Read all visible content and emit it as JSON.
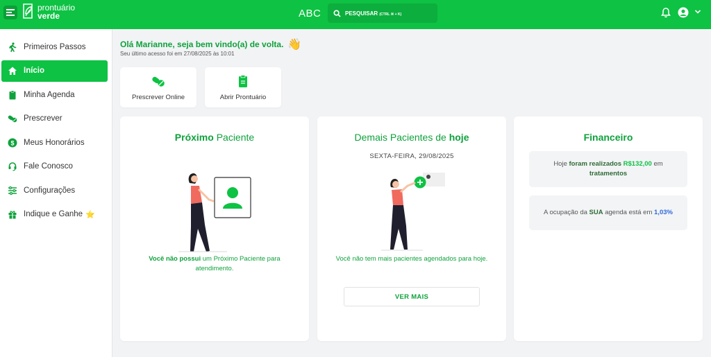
{
  "header": {
    "logo_line1": "prontuário",
    "logo_line2": "verde",
    "center_logo": "ABC",
    "search_label": "PESQUISAR",
    "search_shortcut": "(CTRL ⌘ + K)"
  },
  "sidebar": {
    "items": [
      {
        "label": "Primeiros Passos",
        "icon": "walking-person-icon"
      },
      {
        "label": "Início",
        "icon": "home-icon",
        "active": true
      },
      {
        "label": "Minha Agenda",
        "icon": "clipboard-icon"
      },
      {
        "label": "Prescrever",
        "icon": "pills-icon"
      },
      {
        "label": "Meus Honorários",
        "icon": "dollar-circle-icon"
      },
      {
        "label": "Fale Conosco",
        "icon": "headset-icon"
      },
      {
        "label": "Configurações",
        "icon": "sliders-icon"
      },
      {
        "label": "Indique e Ganhe",
        "icon": "gift-icon",
        "badge": "⭐"
      }
    ]
  },
  "greeting": {
    "title": "Olá Marianne, seja bem vindo(a) de volta.",
    "emoji": "👋",
    "last_access": "Seu último acesso foi em 27/08/2025 às 10:01"
  },
  "quick_actions": [
    {
      "label": "Prescrever Online",
      "icon": "pills-icon"
    },
    {
      "label": "Abrir Prontuário",
      "icon": "clipboard-icon"
    }
  ],
  "next_patient": {
    "title_bold": "Próximo",
    "title_rest": " Paciente",
    "msg_bold": "Você não possui",
    "msg_rest": " um Próximo Paciente para atendimento."
  },
  "other_patients": {
    "title_rest": "Demais Pacientes de ",
    "title_bold": "hoje",
    "date": "SEXTA-FEIRA, 29/08/2025",
    "msg": "Você não tem mais pacientes agendados para hoje.",
    "button": "VER MAIS"
  },
  "financial": {
    "title": "Financeiro",
    "box1_pre": "Hoje ",
    "box1_bold": "foram realizados",
    "box1_value": " R$132,00",
    "box1_mid": " em ",
    "box1_end": "tratamentos",
    "box2_pre": "A ocupação da ",
    "box2_bold": "SUA",
    "box2_mid": " agenda está em ",
    "box2_value": "1,03%"
  },
  "colors": {
    "brand": "#0ec244",
    "brand_text": "#0ea23c",
    "accent_blue": "#2f6bd9",
    "figure_shirt": "#f06a5e"
  }
}
